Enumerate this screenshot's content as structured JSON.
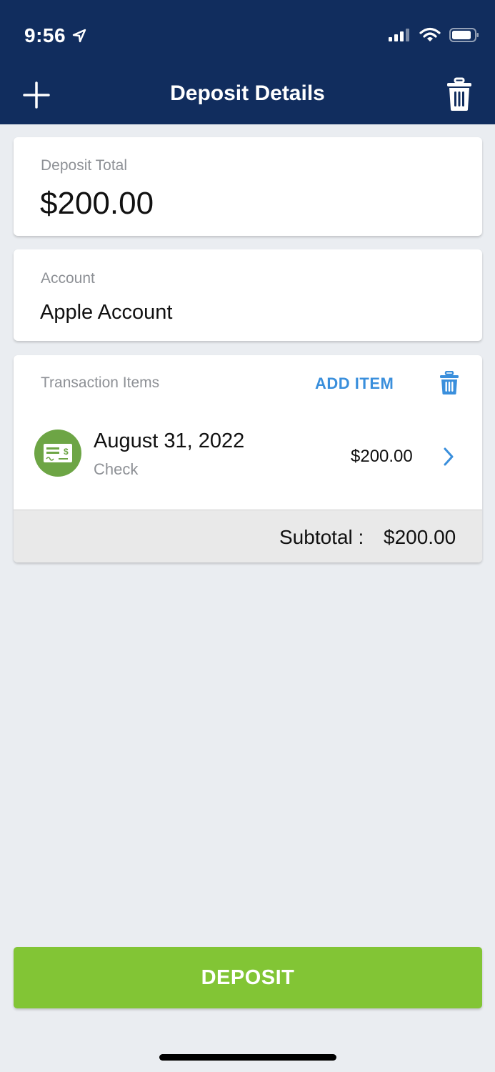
{
  "status_bar": {
    "time": "9:56"
  },
  "nav": {
    "title": "Deposit Details"
  },
  "deposit_total": {
    "label": "Deposit Total",
    "value": "$200.00"
  },
  "account": {
    "label": "Account",
    "value": "Apple Account"
  },
  "transaction_items": {
    "label": "Transaction Items",
    "add_item_label": "ADD ITEM",
    "items": [
      {
        "date": "August 31, 2022",
        "type": "Check",
        "amount": "$200.00",
        "icon": "check-icon"
      }
    ],
    "subtotal_label": "Subtotal :",
    "subtotal_value": "$200.00"
  },
  "deposit_button": {
    "label": "DEPOSIT"
  },
  "colors": {
    "nav_bg": "#112d5e",
    "accent_blue": "#3a8fdc",
    "deposit_green": "#82c535",
    "item_badge_green": "#6da545",
    "page_bg": "#eaedf1"
  }
}
